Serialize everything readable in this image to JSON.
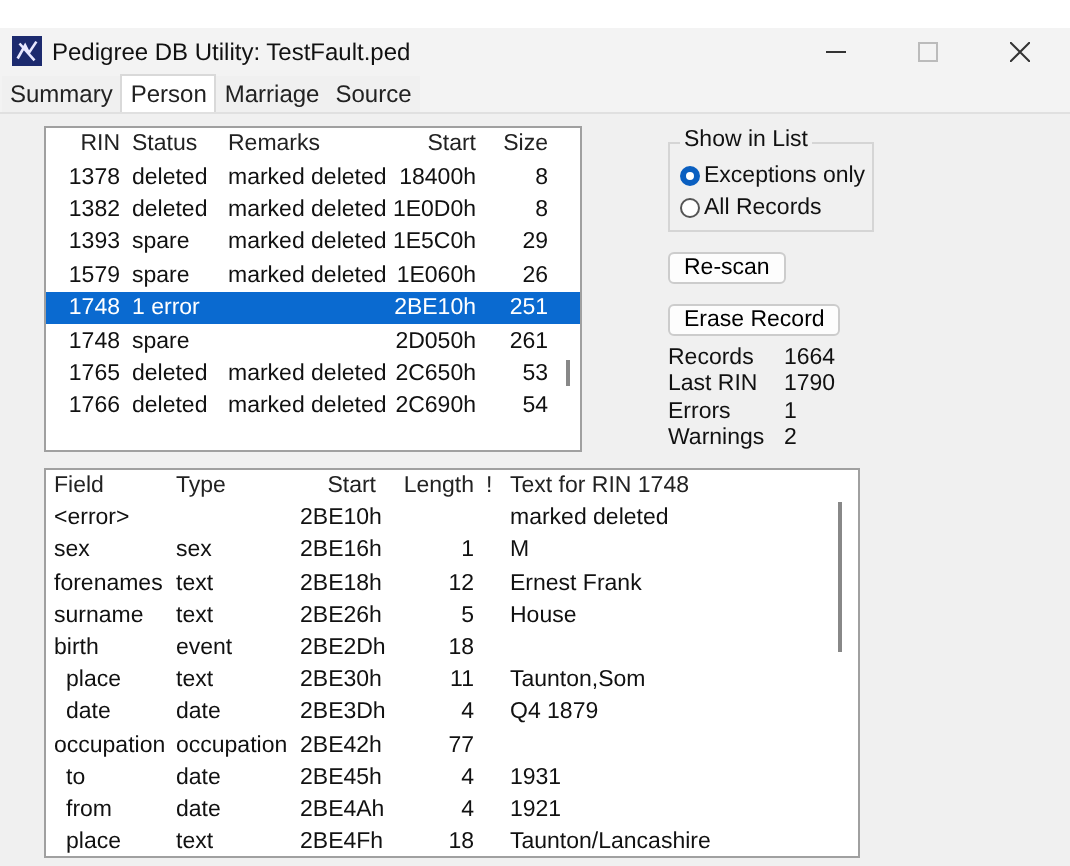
{
  "window": {
    "title": "Pedigree DB Utility: TestFault.ped"
  },
  "tabs": [
    {
      "label": "Summary",
      "selected": false
    },
    {
      "label": "Person",
      "selected": true
    },
    {
      "label": "Marriage",
      "selected": false
    },
    {
      "label": "Source",
      "selected": false
    }
  ],
  "records_table": {
    "columns": [
      "RIN",
      "Status",
      "Remarks",
      "Start",
      "Size"
    ],
    "rows": [
      {
        "cells": [
          "1378",
          "deleted",
          "marked deleted",
          "18400h",
          "8"
        ],
        "selected": false
      },
      {
        "cells": [
          "1382",
          "deleted",
          "marked deleted",
          "1E0D0h",
          "8"
        ],
        "selected": false
      },
      {
        "cells": [
          "1393",
          "spare",
          "marked deleted",
          "1E5C0h",
          "29"
        ],
        "selected": false
      },
      {
        "cells": [
          "1579",
          "spare",
          "marked deleted",
          "1E060h",
          "26"
        ],
        "selected": false
      },
      {
        "cells": [
          "1748",
          "1 error",
          "",
          "2BE10h",
          "251"
        ],
        "selected": true
      },
      {
        "cells": [
          "1748",
          "spare",
          "",
          "2D050h",
          "261"
        ],
        "selected": false
      },
      {
        "cells": [
          "1765",
          "deleted",
          "marked deleted",
          "2C650h",
          "53"
        ],
        "selected": false
      },
      {
        "cells": [
          "1766",
          "deleted",
          "marked deleted",
          "2C690h",
          "54"
        ],
        "selected": false
      }
    ]
  },
  "show_in_list": {
    "title": "Show in List",
    "options": [
      {
        "label": "Exceptions only",
        "selected": true
      },
      {
        "label": "All Records",
        "selected": false
      }
    ]
  },
  "buttons": [
    "Re-scan",
    "Erase Record"
  ],
  "stats": [
    {
      "label": "Records",
      "value": "1664"
    },
    {
      "label": "Last RIN",
      "value": "1790"
    },
    {
      "label": "Errors",
      "value": "1"
    },
    {
      "label": "Warnings",
      "value": "2"
    }
  ],
  "fields_table": {
    "columns": [
      "Field",
      "Type",
      "Start",
      "Length",
      "!",
      "Text for RIN 1748"
    ],
    "rows": [
      {
        "cells": [
          "<error>",
          "",
          "2BE10h",
          "",
          "",
          "marked deleted"
        ]
      },
      {
        "cells": [
          "sex",
          "sex",
          "2BE16h",
          "1",
          "",
          "M"
        ]
      },
      {
        "cells": [
          "forenames",
          "text",
          "2BE18h",
          "12",
          "",
          "Ernest Frank"
        ]
      },
      {
        "cells": [
          "surname",
          "text",
          "2BE26h",
          "5",
          "",
          "House"
        ]
      },
      {
        "cells": [
          "birth",
          "event",
          "2BE2Dh",
          "18",
          "",
          ""
        ],
        "children": [
          {
            "cells": [
              "place",
              "text",
              "2BE30h",
              "11",
              "",
              "Taunton,Som"
            ]
          },
          {
            "cells": [
              "date",
              "date",
              "2BE3Dh",
              "4",
              "",
              "Q4 1879"
            ]
          }
        ]
      },
      {
        "cells": [
          "occupation",
          "occupation",
          "2BE42h",
          "77",
          "",
          ""
        ],
        "children": [
          {
            "cells": [
              "to",
              "date",
              "2BE45h",
              "4",
              "",
              "1931"
            ]
          },
          {
            "cells": [
              "from",
              "date",
              "2BE4Ah",
              "4",
              "",
              "1921"
            ]
          },
          {
            "cells": [
              "place",
              "text",
              "2BE4Fh",
              "18",
              "",
              "Taunton/Lancashire"
            ]
          }
        ]
      }
    ]
  }
}
